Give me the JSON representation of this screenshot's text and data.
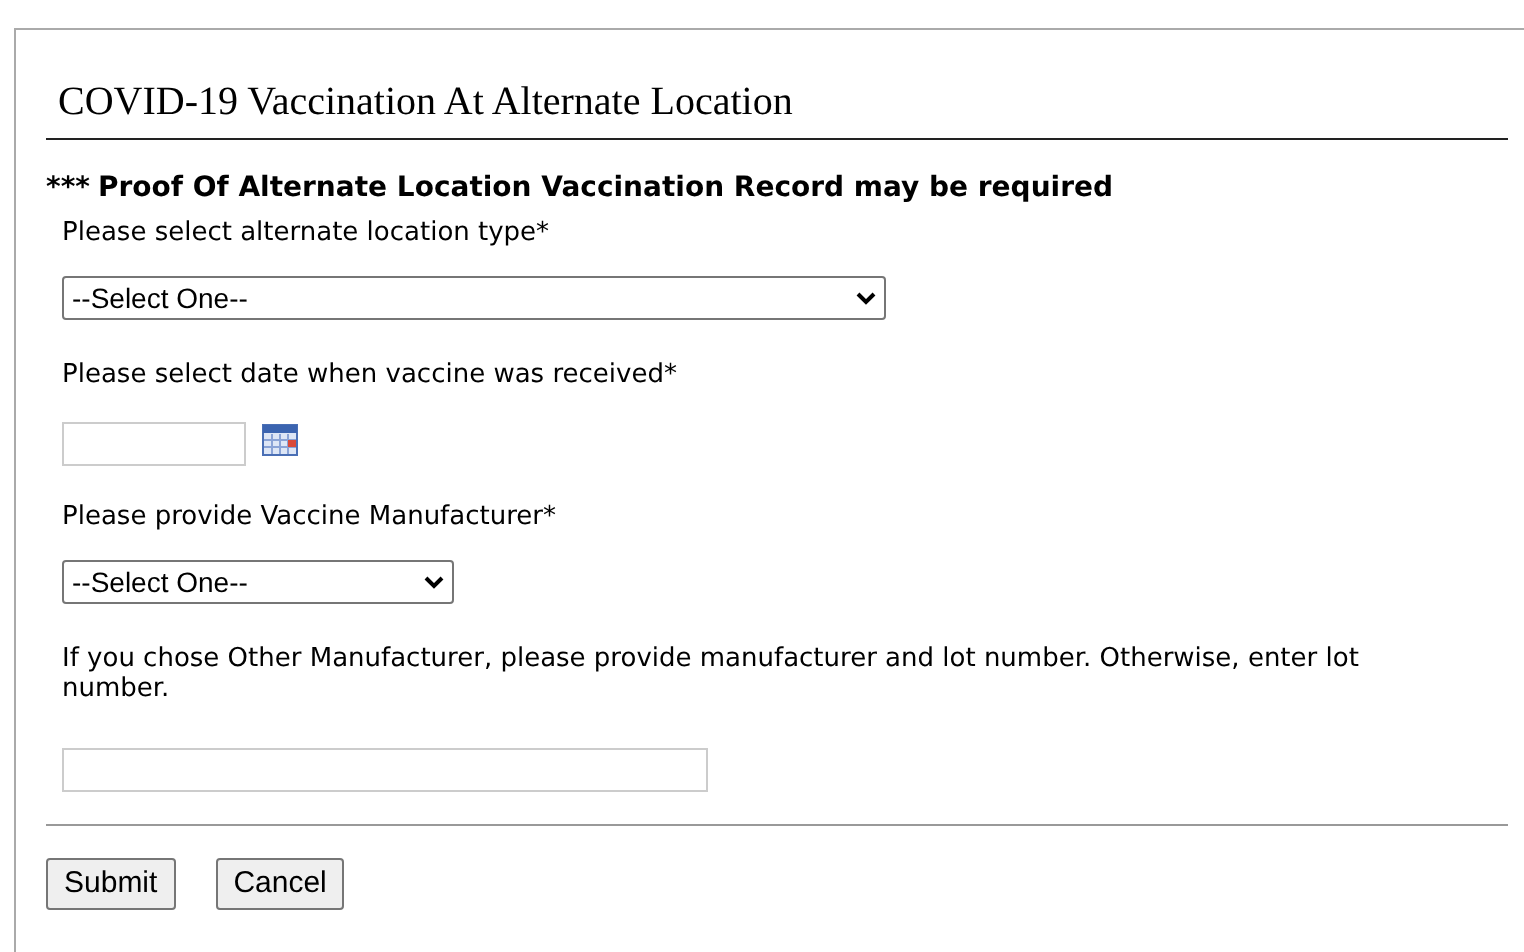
{
  "title": "COVID-19 Vaccination At Alternate Location",
  "notice": {
    "stars": "***",
    "text": "Proof Of Alternate Location Vaccination Record may be required"
  },
  "fields": [
    {
      "kind": "wideselect",
      "label": "Please select alternate location type*",
      "value": "--Select One--"
    },
    {
      "kind": "date",
      "label": "Please select date when vaccine was received*"
    },
    {
      "kind": "select",
      "label": "Please provide Vaccine Manufacturer*",
      "value": "--Select One--"
    },
    {
      "kind": "text",
      "label": "If you chose Other Manufacturer, please provide manufacturer and lot number. Otherwise, enter lot number."
    }
  ],
  "buttons": [
    "Submit",
    "Cancel"
  ]
}
